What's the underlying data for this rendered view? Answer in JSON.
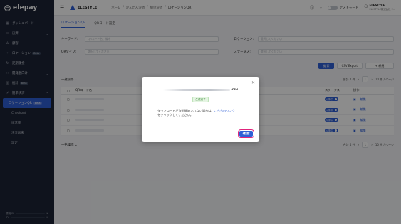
{
  "app": {
    "logo": "elepay"
  },
  "sidebar": {
    "items": [
      {
        "label": "ダッシュボード",
        "icon": "grid-icon",
        "chev": ""
      },
      {
        "label": "決済",
        "icon": "card-icon",
        "chev": "⌄"
      },
      {
        "label": "顧客",
        "icon": "user-icon",
        "chev": ""
      },
      {
        "label": "ロケーション",
        "icon": "pin-icon",
        "badge": "Beta",
        "chev": ""
      },
      {
        "label": "定期課金",
        "icon": "repeat-icon",
        "chev": ""
      },
      {
        "label": "開発者向け",
        "icon": "code-icon",
        "chev": "⌄"
      },
      {
        "label": "統計",
        "icon": "chart-icon",
        "badge": "Beta",
        "chev": ""
      },
      {
        "label": "簡単決済",
        "icon": "bolt-icon",
        "chev": "⌃"
      }
    ],
    "active": {
      "label": "ロケーションQR",
      "badge": "Beta"
    },
    "subitems": [
      "Checkout",
      "請求書",
      "決済端末",
      "設定"
    ],
    "footer": [
      "環境ID:",
      "ID:"
    ]
  },
  "header": {
    "brand": "ELESTYLE",
    "breadcrumb": [
      "ホーム",
      "/",
      "かんたん決済",
      "/",
      "簡単決済",
      "/",
      "ロケーションQR"
    ],
    "test_mode": "テストモード",
    "user_name": "ELESTYLE",
    "user_sub": "ELESTYLE株式会社 E..."
  },
  "tabs": [
    "ロケーションQR",
    "QRコード設定"
  ],
  "filters": {
    "keyword_label": "キーワード:",
    "keyword_placeholder": "QRコード名、備考",
    "location_label": "ロケーション:",
    "location_placeholder": "選択してください",
    "qrtype_label": "QRタイプ:",
    "qrtype_placeholder": "選択してください",
    "status_label": "ステータス:",
    "status_placeholder": "選択してください"
  },
  "actions": {
    "search": "検 索",
    "csv": "CSV Export",
    "new": "+ 新規"
  },
  "toolbar": {
    "bulk": "一括操作 ⌄",
    "total": "合計 4 件",
    "page": "1",
    "per_page": "10 件 / ページ"
  },
  "table": {
    "headers": [
      "QRコード名",
      "ロ",
      "備考",
      "ステータス",
      "操作"
    ],
    "rows": [
      {
        "status": "公開中",
        "edit": "編集"
      },
      {
        "status": "公開中",
        "edit": "編集"
      },
      {
        "status": "公開中",
        "edit": "編集"
      },
      {
        "status": "公開中",
        "edit": "編集"
      }
    ]
  },
  "modal": {
    "ext": ".csv",
    "done": "生成完了",
    "msg_pre": "ダウンロードが自動開始されない場合は、",
    "msg_link": "こちらのリンク",
    "msg_post": "をクリックしてください。",
    "ok": "確 認"
  },
  "colors": {
    "accent": "#2f5fd6",
    "sidebar": "#1c2436",
    "highlight": "#e0237b"
  }
}
